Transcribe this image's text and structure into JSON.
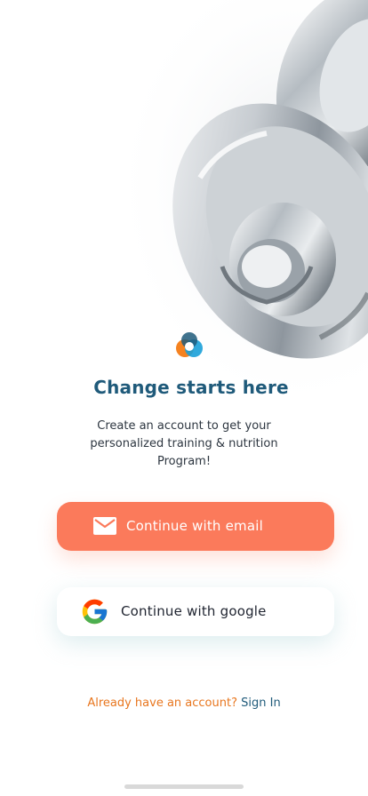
{
  "hero": {
    "image_alt": "chrome dumbbell"
  },
  "brand": {
    "logo": "app-logo-icon",
    "colors": {
      "orange": "#f58220",
      "blue": "#1aa0d8",
      "navy": "#1f5a7a",
      "coral": "#fb7a5b"
    }
  },
  "headline": "Change starts here",
  "subtitle": "Create an account to get your personalized training & nutrition Program!",
  "buttons": {
    "email": {
      "label": "Continue with email",
      "icon": "mail-icon"
    },
    "google": {
      "label": "Continue with google",
      "icon": "google-icon"
    }
  },
  "signin": {
    "prompt": "Already have an account?",
    "link": "Sign In"
  }
}
